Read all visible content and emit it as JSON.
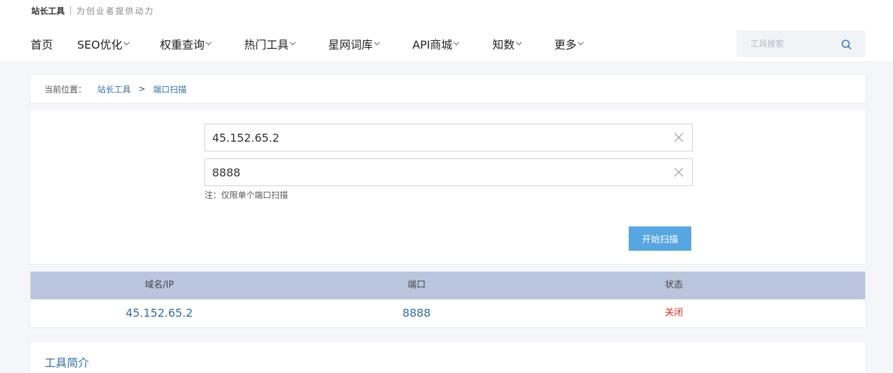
{
  "brand": {
    "name": "站长工具",
    "slogan": "为创业者提供动力"
  },
  "nav": [
    {
      "label": "首页",
      "has_dropdown": false
    },
    {
      "label": "SEO优化",
      "has_dropdown": true
    },
    {
      "label": "权重查询",
      "has_dropdown": true
    },
    {
      "label": "热门工具",
      "has_dropdown": true
    },
    {
      "label": "星网词库",
      "has_dropdown": true
    },
    {
      "label": "API商城",
      "has_dropdown": true
    },
    {
      "label": "知数",
      "has_dropdown": true
    },
    {
      "label": "更多",
      "has_dropdown": true
    }
  ],
  "search": {
    "placeholder": "工具搜索",
    "icon": "search-icon"
  },
  "breadcrumb": {
    "label": "当前位置：",
    "items": [
      "站长工具",
      "端口扫描"
    ],
    "separator": ">"
  },
  "form": {
    "host_value": "45.152.65.2",
    "port_value": "8888",
    "note": "注：仅限单个端口扫描",
    "submit_label": "开始扫描"
  },
  "result": {
    "headers": [
      "域名/IP",
      "端口",
      "状态"
    ],
    "rows": [
      {
        "host": "45.152.65.2",
        "port": "8888",
        "status": "关闭"
      }
    ]
  },
  "intro": {
    "title": "工具简介"
  },
  "colors": {
    "accent": "#2e6ea8",
    "button": "#56a6e2",
    "table_header": "#b9c6de",
    "closed": "#e3251a"
  }
}
